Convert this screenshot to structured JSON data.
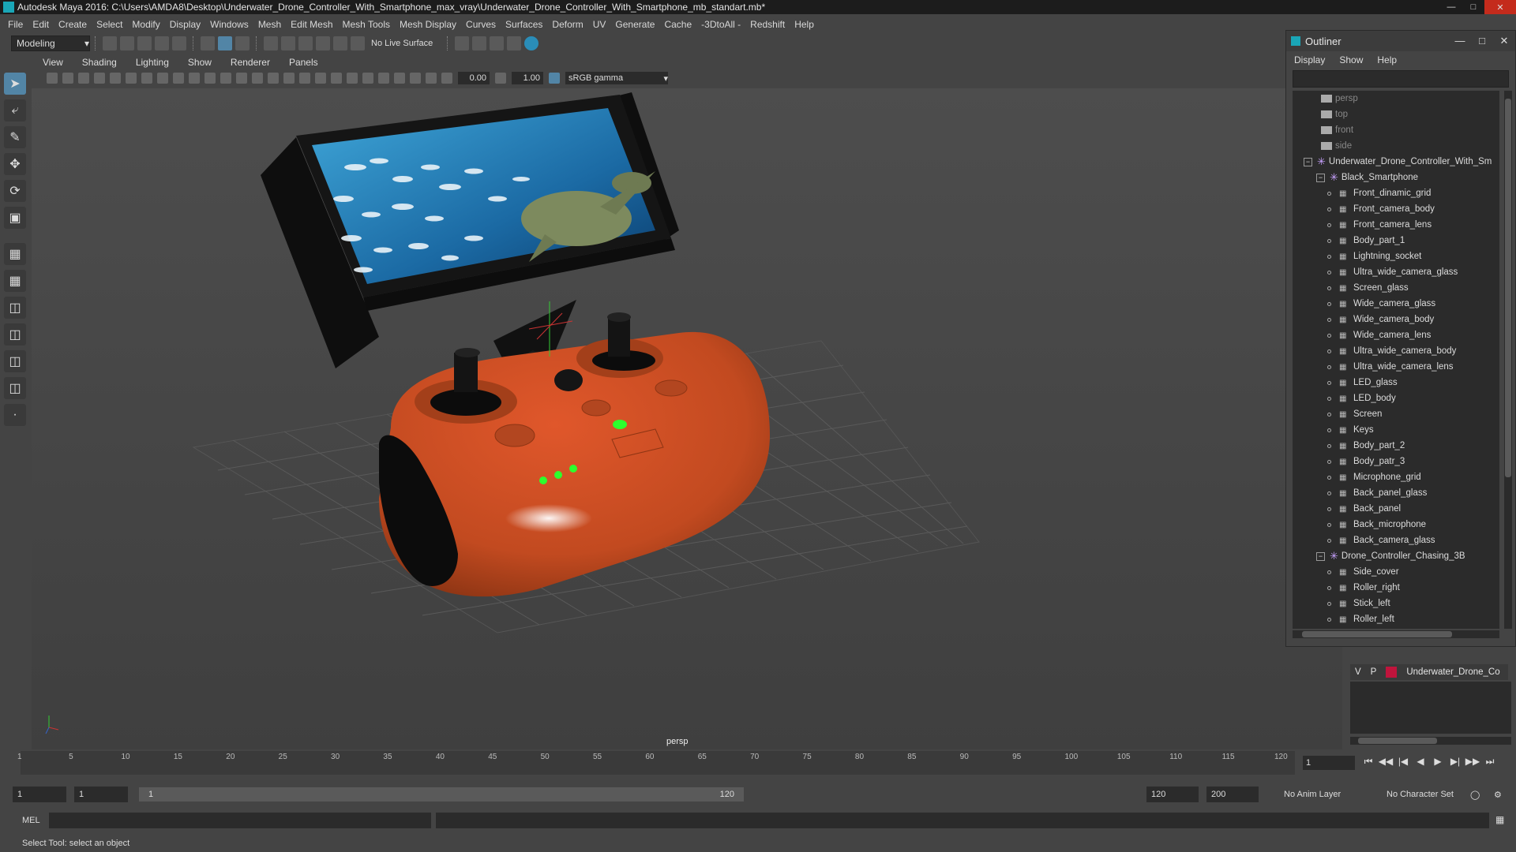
{
  "titlebar": {
    "title": "Autodesk Maya 2016: C:\\Users\\AMDA8\\Desktop\\Underwater_Drone_Controller_With_Smartphone_max_vray\\Underwater_Drone_Controller_With_Smartphone_mb_standart.mb*"
  },
  "menu": [
    "File",
    "Edit",
    "Create",
    "Select",
    "Modify",
    "Display",
    "Windows",
    "Mesh",
    "Edit Mesh",
    "Mesh Tools",
    "Mesh Display",
    "Curves",
    "Surfaces",
    "Deform",
    "UV",
    "Generate",
    "Cache",
    "-3DtoAll -",
    "Redshift",
    "Help"
  ],
  "shelf": {
    "mode": "Modeling",
    "live_surface": "No Live Surface"
  },
  "viewport_menu": [
    "View",
    "Shading",
    "Lighting",
    "Show",
    "Renderer",
    "Panels"
  ],
  "viewport_toolbar": {
    "field1": "0.00",
    "field2": "1.00",
    "color_space": "sRGB gamma"
  },
  "viewport": {
    "camera_label": "persp",
    "axis_x": "x",
    "axis_y": "y"
  },
  "outliner": {
    "title": "Outliner",
    "menu": [
      "Display",
      "Show",
      "Help"
    ],
    "items": [
      {
        "label": "persp",
        "type": "camera",
        "depth": 0
      },
      {
        "label": "top",
        "type": "camera",
        "depth": 0
      },
      {
        "label": "front",
        "type": "camera",
        "depth": 0
      },
      {
        "label": "side",
        "type": "camera",
        "depth": 0
      },
      {
        "label": "Underwater_Drone_Controller_With_Sm",
        "type": "group",
        "depth": 0,
        "expander": "−"
      },
      {
        "label": "Black_Smartphone",
        "type": "group",
        "depth": 1,
        "expander": "−"
      },
      {
        "label": "Front_dinamic_grid",
        "type": "mesh",
        "depth": 2
      },
      {
        "label": "Front_camera_body",
        "type": "mesh",
        "depth": 2
      },
      {
        "label": "Front_camera_lens",
        "type": "mesh",
        "depth": 2
      },
      {
        "label": "Body_part_1",
        "type": "mesh",
        "depth": 2
      },
      {
        "label": "Lightning_socket",
        "type": "mesh",
        "depth": 2
      },
      {
        "label": "Ultra_wide_camera_glass",
        "type": "mesh",
        "depth": 2
      },
      {
        "label": "Screen_glass",
        "type": "mesh",
        "depth": 2
      },
      {
        "label": "Wide_camera_glass",
        "type": "mesh",
        "depth": 2
      },
      {
        "label": "Wide_camera_body",
        "type": "mesh",
        "depth": 2
      },
      {
        "label": "Wide_camera_lens",
        "type": "mesh",
        "depth": 2
      },
      {
        "label": "Ultra_wide_camera_body",
        "type": "mesh",
        "depth": 2
      },
      {
        "label": "Ultra_wide_camera_lens",
        "type": "mesh",
        "depth": 2
      },
      {
        "label": "LED_glass",
        "type": "mesh",
        "depth": 2
      },
      {
        "label": "LED_body",
        "type": "mesh",
        "depth": 2
      },
      {
        "label": "Screen",
        "type": "mesh",
        "depth": 2
      },
      {
        "label": "Keys",
        "type": "mesh",
        "depth": 2
      },
      {
        "label": "Body_part_2",
        "type": "mesh",
        "depth": 2
      },
      {
        "label": "Body_patr_3",
        "type": "mesh",
        "depth": 2
      },
      {
        "label": "Microphone_grid",
        "type": "mesh",
        "depth": 2
      },
      {
        "label": "Back_panel_glass",
        "type": "mesh",
        "depth": 2
      },
      {
        "label": "Back_panel",
        "type": "mesh",
        "depth": 2
      },
      {
        "label": "Back_microphone",
        "type": "mesh",
        "depth": 2
      },
      {
        "label": "Back_camera_glass",
        "type": "mesh",
        "depth": 2
      },
      {
        "label": "Drone_Controller_Chasing_3B",
        "type": "group",
        "depth": 1,
        "expander": "−"
      },
      {
        "label": "Side_cover",
        "type": "mesh",
        "depth": 2
      },
      {
        "label": "Roller_right",
        "type": "mesh",
        "depth": 2
      },
      {
        "label": "Stick_left",
        "type": "mesh",
        "depth": 2
      },
      {
        "label": "Roller_left",
        "type": "mesh",
        "depth": 2
      }
    ]
  },
  "layers": {
    "v": "V",
    "p": "P",
    "name": "Underwater_Drone_Co",
    "color": "#c0143c"
  },
  "timeline": {
    "ticks": [
      "1",
      "5",
      "10",
      "15",
      "20",
      "25",
      "30",
      "35",
      "40",
      "45",
      "50",
      "55",
      "60",
      "65",
      "70",
      "75",
      "80",
      "85",
      "90",
      "95",
      "100",
      "105",
      "110",
      "115",
      "120"
    ],
    "current_frame": "1"
  },
  "range": {
    "start": "1",
    "start2": "1",
    "slider_start": "1",
    "slider_end": "120",
    "end": "120",
    "end2": "200",
    "anim_layer": "No Anim Layer",
    "char_set": "No Character Set"
  },
  "mel": {
    "label": "MEL"
  },
  "status": {
    "text": "Select Tool: select an object"
  }
}
